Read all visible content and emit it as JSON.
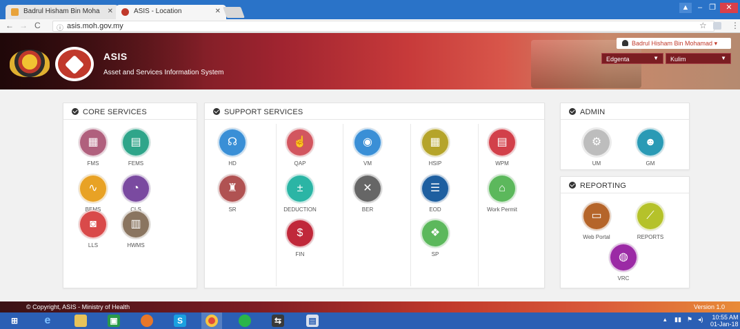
{
  "browser": {
    "tabs": [
      {
        "label": "Badrul Hisham Bin Moha",
        "favicon_color": "#e8a33b"
      },
      {
        "label": "ASIS - Location",
        "favicon_color": "#c0392b"
      }
    ],
    "url": "asis.moh.gov.my"
  },
  "header": {
    "title": "ASIS",
    "subtitle": "Asset and Services Information System",
    "user": "Badrul Hisham Bin Mohamad",
    "company_select": "Edgenta",
    "location_select": "Kulim"
  },
  "core_services": {
    "title": "CORE SERVICES",
    "items": [
      {
        "label": "FMS",
        "color": "#b0607d",
        "icon": "building-icon"
      },
      {
        "label": "FEMS",
        "color": "#2fa58a",
        "icon": "hospital-building-icon"
      },
      {
        "label": "BEMS",
        "color": "#e8a225",
        "icon": "heartbeat-icon"
      },
      {
        "label": "CLS",
        "color": "#7a4aa0",
        "icon": "vacuum-icon"
      },
      {
        "label": "LLS",
        "color": "#d94a4a",
        "icon": "washing-machine-icon"
      },
      {
        "label": "HWMS",
        "color": "#8a7560",
        "icon": "waste-bin-icon"
      }
    ]
  },
  "support_services": {
    "title": "SUPPORT SERVICES",
    "items": [
      {
        "label": "HD",
        "color": "#3a8fd6",
        "icon": "headset-icon"
      },
      {
        "label": "QAP",
        "color": "#d2565f",
        "icon": "thumbs-up-icon"
      },
      {
        "label": "VM",
        "color": "#3a8fd6",
        "icon": "money-stack-icon"
      },
      {
        "label": "HSIP",
        "color": "#b5a42a",
        "icon": "hospital-icon"
      },
      {
        "label": "WPM",
        "color": "#d2404a",
        "icon": "clipboard-icon"
      },
      {
        "label": "SR",
        "color": "#b05252",
        "icon": "spray-icon"
      },
      {
        "label": "DEDUCTION",
        "color": "#2bb5a5",
        "icon": "plus-minus-icon"
      },
      {
        "label": "BER",
        "color": "#666666",
        "icon": "tools-icon"
      },
      {
        "label": "EOD",
        "color": "#1e5fa0",
        "icon": "database-gear-icon"
      },
      {
        "label": "Work Permit",
        "color": "#5cb85c",
        "icon": "permit-icon"
      },
      {
        "label": "FIN",
        "color": "#c0283a",
        "icon": "dollar-icon"
      },
      {
        "label": "SP",
        "color": "#5cb85c",
        "icon": "handshake-icon"
      }
    ]
  },
  "admin": {
    "title": "ADMIN",
    "items": [
      {
        "label": "UM",
        "color": "#bdbdbd",
        "icon": "gear-icon"
      },
      {
        "label": "GM",
        "color": "#2a9ab5",
        "icon": "users-icon"
      }
    ]
  },
  "reporting": {
    "title": "REPORTING",
    "items": [
      {
        "label": "Web Portal",
        "color": "#b5652a",
        "icon": "web-portal-icon"
      },
      {
        "label": "REPORTS",
        "color": "#b5c22a",
        "icon": "line-chart-icon"
      },
      {
        "label": "VRC",
        "color": "#9b2aa5",
        "icon": "globe-icon"
      }
    ]
  },
  "footer": {
    "copyright": "© Copyright, ASIS - Ministry of Health",
    "version": "Version 1.0"
  },
  "taskbar": {
    "time": "10:55 AM",
    "date": "01-Jan-18"
  }
}
